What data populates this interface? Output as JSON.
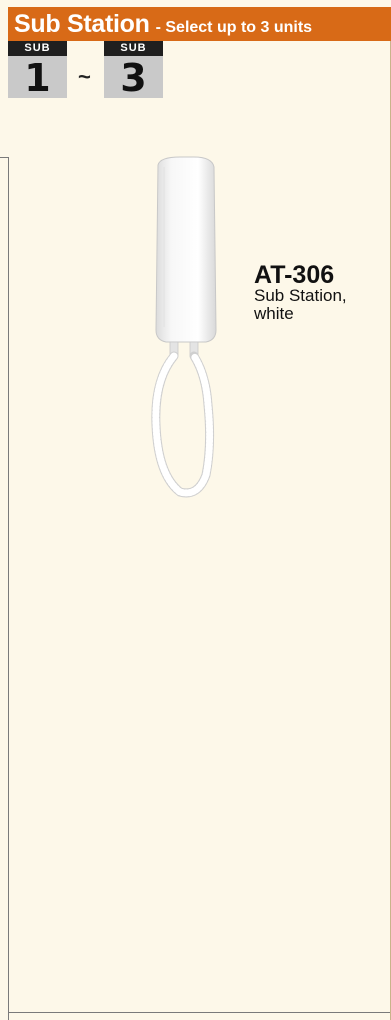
{
  "header": {
    "title": "Sub Station",
    "subtitle": "- Select up to 3 units"
  },
  "badges": {
    "label": "SUB",
    "min": "1",
    "separator": "~",
    "max": "3"
  },
  "product": {
    "model": "AT-306",
    "description_line1": "Sub Station,",
    "description_line2": "white"
  },
  "colors": {
    "header_bg": "#d86a17",
    "page_bg": "#fdf8e9",
    "badge_top": "#1f1f1f",
    "badge_bottom": "#c9c9c9"
  },
  "icons": {
    "product_image": "white-intercom-handset"
  }
}
